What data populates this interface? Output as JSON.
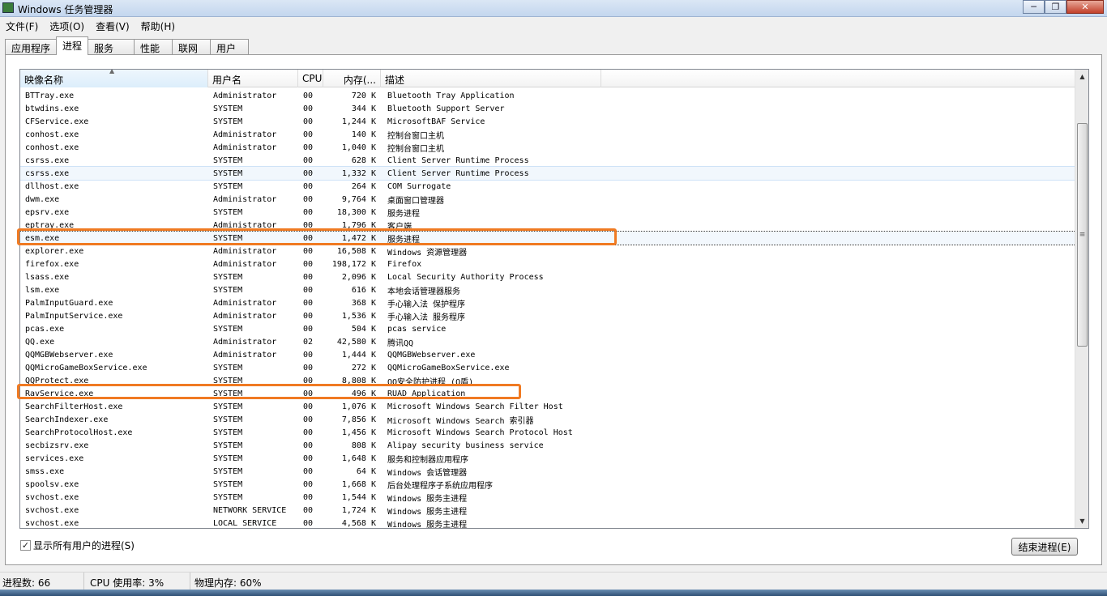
{
  "window": {
    "title": "Windows 任务管理器",
    "minimize": "─",
    "maximize": "❐",
    "close": "✕"
  },
  "menu": [
    "文件(F)",
    "选项(O)",
    "查看(V)",
    "帮助(H)"
  ],
  "tabs": [
    "应用程序",
    "进程",
    "服务",
    "性能",
    "联网",
    "用户"
  ],
  "columns": {
    "name": "映像名称",
    "user": "用户名",
    "cpu": "CPU",
    "mem": "内存(...",
    "desc": "描述"
  },
  "rows": [
    [
      "BTTray.exe",
      "Administrator",
      "00",
      "720 K",
      "Bluetooth Tray Application"
    ],
    [
      "btwdins.exe",
      "SYSTEM",
      "00",
      "344 K",
      "Bluetooth Support Server"
    ],
    [
      "CFService.exe",
      "SYSTEM",
      "00",
      "1,244 K",
      "MicrosoftBAF Service"
    ],
    [
      "conhost.exe",
      "Administrator",
      "00",
      "140 K",
      "控制台窗口主机"
    ],
    [
      "conhost.exe",
      "Administrator",
      "00",
      "1,040 K",
      "控制台窗口主机"
    ],
    [
      "csrss.exe",
      "SYSTEM",
      "00",
      "628 K",
      "Client Server Runtime Process"
    ],
    [
      "csrss.exe",
      "SYSTEM",
      "00",
      "1,332 K",
      "Client Server Runtime Process"
    ],
    [
      "dllhost.exe",
      "SYSTEM",
      "00",
      "264 K",
      "COM Surrogate"
    ],
    [
      "dwm.exe",
      "Administrator",
      "00",
      "9,764 K",
      "桌面窗口管理器"
    ],
    [
      "epsrv.exe",
      "SYSTEM",
      "00",
      "18,300 K",
      "服务进程"
    ],
    [
      "eptray.exe",
      "Administrator",
      "00",
      "1,796 K",
      "客户端"
    ],
    [
      "esm.exe",
      "SYSTEM",
      "00",
      "1,472 K",
      "服务进程"
    ],
    [
      "explorer.exe",
      "Administrator",
      "00",
      "16,508 K",
      "Windows 资源管理器"
    ],
    [
      "firefox.exe",
      "Administrator",
      "00",
      "198,172 K",
      "Firefox"
    ],
    [
      "lsass.exe",
      "SYSTEM",
      "00",
      "2,096 K",
      "Local Security Authority Process"
    ],
    [
      "lsm.exe",
      "SYSTEM",
      "00",
      "616 K",
      "本地会话管理器服务"
    ],
    [
      "PalmInputGuard.exe",
      "Administrator",
      "00",
      "368 K",
      "手心输入法 保护程序"
    ],
    [
      "PalmInputService.exe",
      "Administrator",
      "00",
      "1,536 K",
      "手心输入法 服务程序"
    ],
    [
      "pcas.exe",
      "SYSTEM",
      "00",
      "504 K",
      "pcas service"
    ],
    [
      "QQ.exe",
      "Administrator",
      "02",
      "42,580 K",
      "腾讯QQ"
    ],
    [
      "QQMGBWebserver.exe",
      "Administrator",
      "00",
      "1,444 K",
      "QQMGBWebserver.exe"
    ],
    [
      "QQMicroGameBoxService.exe",
      "SYSTEM",
      "00",
      "272 K",
      "QQMicroGameBoxService.exe"
    ],
    [
      "QQProtect.exe",
      "SYSTEM",
      "00",
      "8,808 K",
      "QQ安全防护进程 (Q盾)"
    ],
    [
      "RavService.exe",
      "SYSTEM",
      "00",
      "496 K",
      "RUAD Application"
    ],
    [
      "SearchFilterHost.exe",
      "SYSTEM",
      "00",
      "1,076 K",
      "Microsoft Windows Search Filter Host"
    ],
    [
      "SearchIndexer.exe",
      "SYSTEM",
      "00",
      "7,856 K",
      "Microsoft Windows Search 索引器"
    ],
    [
      "SearchProtocolHost.exe",
      "SYSTEM",
      "00",
      "1,456 K",
      "Microsoft Windows Search Protocol Host"
    ],
    [
      "secbizsrv.exe",
      "SYSTEM",
      "00",
      "808 K",
      "Alipay security business service"
    ],
    [
      "services.exe",
      "SYSTEM",
      "00",
      "1,648 K",
      "服务和控制器应用程序"
    ],
    [
      "smss.exe",
      "SYSTEM",
      "00",
      "64 K",
      "Windows 会话管理器"
    ],
    [
      "spoolsv.exe",
      "SYSTEM",
      "00",
      "1,668 K",
      "后台处理程序子系统应用程序"
    ],
    [
      "svchost.exe",
      "SYSTEM",
      "00",
      "1,544 K",
      "Windows 服务主进程"
    ],
    [
      "svchost.exe",
      "NETWORK SERVICE",
      "00",
      "1,724 K",
      "Windows 服务主进程"
    ],
    [
      "svchost.exe",
      "LOCAL SERVICE",
      "00",
      "4,568 K",
      "Windows 服务主进程"
    ]
  ],
  "show_all_label": "显示所有用户的进程(S)",
  "end_process_label": "结束进程(E)",
  "status": {
    "processes": "进程数: 66",
    "cpu": "CPU 使用率: 3%",
    "memory": "物理内存: 60%"
  },
  "colors": {
    "annotation": "#f07a22",
    "titlebar": "#c3d6ee"
  }
}
